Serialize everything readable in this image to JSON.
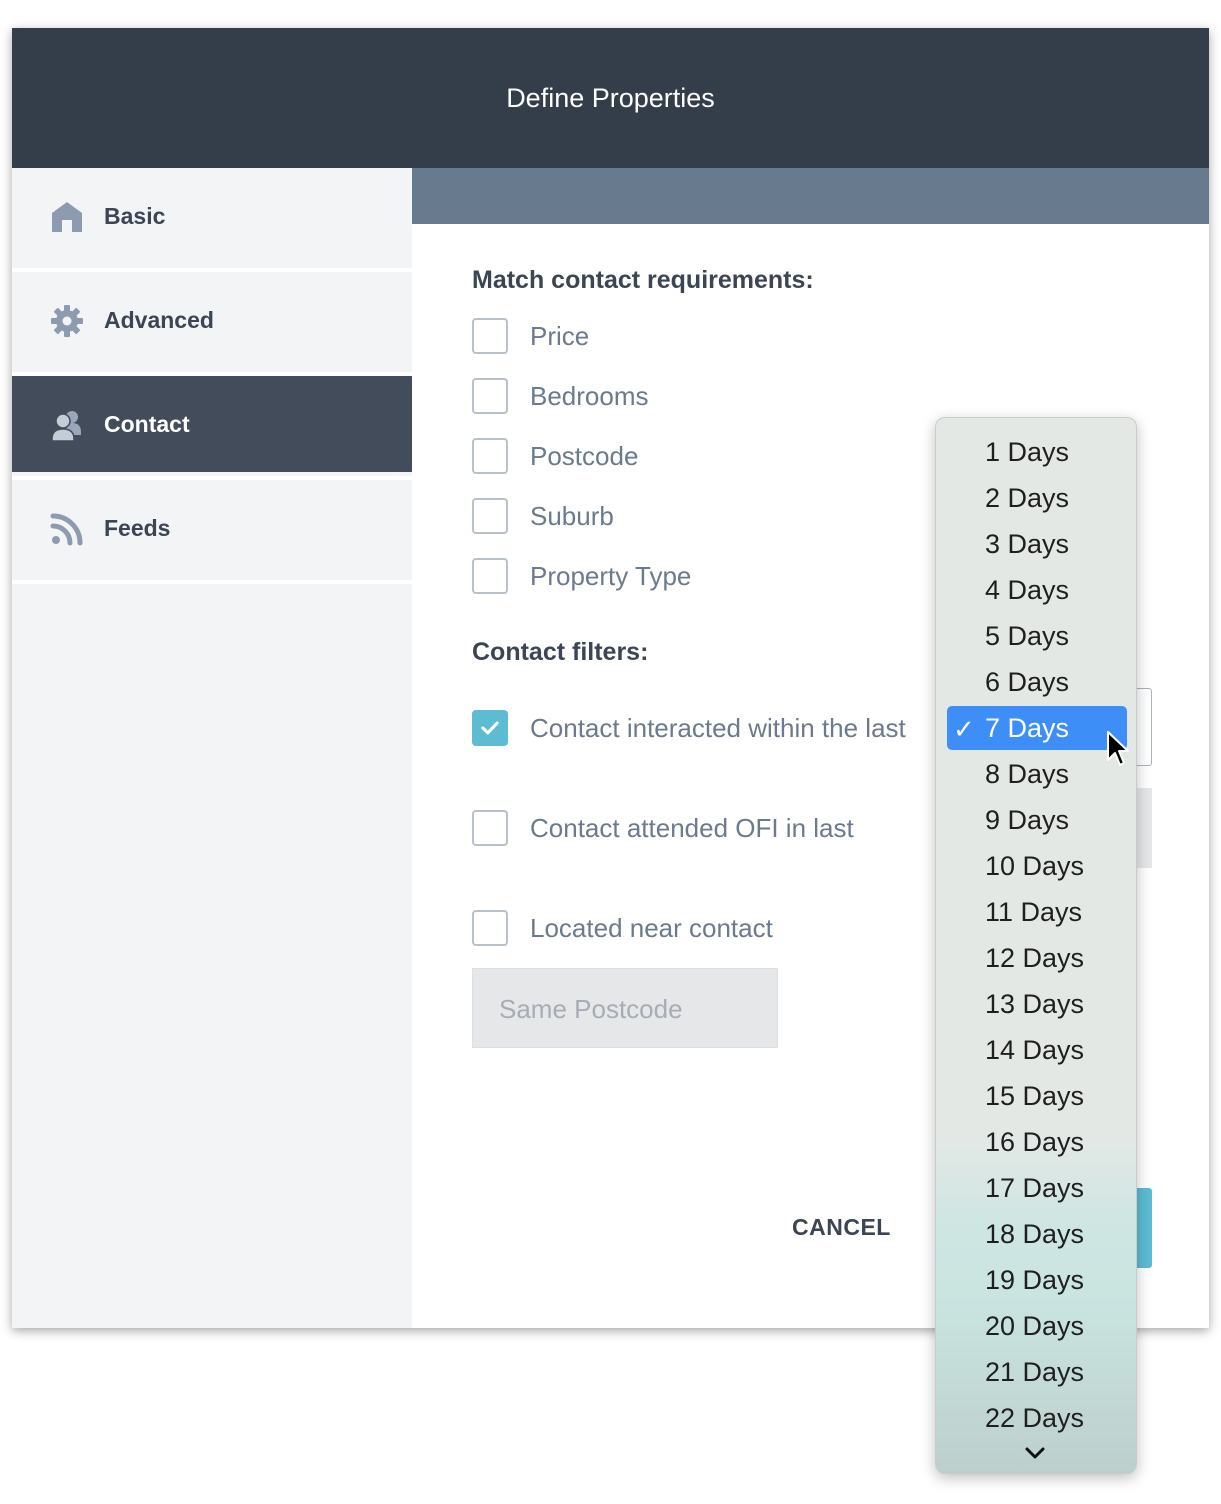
{
  "header": {
    "title": "Define Properties"
  },
  "sidebar": {
    "items": [
      {
        "label": "Basic",
        "icon": "home-icon",
        "active": false
      },
      {
        "label": "Advanced",
        "icon": "gear-icon",
        "active": false
      },
      {
        "label": "Contact",
        "icon": "contacts-icon",
        "active": true
      },
      {
        "label": "Feeds",
        "icon": "rss-icon",
        "active": false
      }
    ]
  },
  "match": {
    "title": "Match contact requirements:",
    "items": [
      {
        "label": "Price",
        "checked": false
      },
      {
        "label": "Bedrooms",
        "checked": false
      },
      {
        "label": "Postcode",
        "checked": false
      },
      {
        "label": "Suburb",
        "checked": false
      },
      {
        "label": "Property Type",
        "checked": false
      }
    ]
  },
  "filters": {
    "title": "Contact filters:",
    "interacted": {
      "label": "Contact interacted within the last",
      "checked": true
    },
    "attended": {
      "label": "Contact attended OFI in last",
      "checked": false
    },
    "near": {
      "label": "Located near contact",
      "checked": false
    },
    "near_select": {
      "value": "Same Postcode"
    }
  },
  "actions": {
    "cancel_label": "CANCEL"
  },
  "dropdown": {
    "selected": "7 Days",
    "checkmark": "✓",
    "options": [
      "1 Days",
      "2 Days",
      "3 Days",
      "4 Days",
      "5 Days",
      "6 Days",
      "7 Days",
      "8 Days",
      "9 Days",
      "10 Days",
      "11 Days",
      "12 Days",
      "13 Days",
      "14 Days",
      "15 Days",
      "16 Days",
      "17 Days",
      "18 Days",
      "19 Days",
      "20 Days",
      "21 Days",
      "22 Days"
    ]
  },
  "colors": {
    "header_bg": "#343d4a",
    "active_nav_bg": "#434c5b",
    "subbar_bg": "#687a8e",
    "checkbox_checked": "#5bbcd3",
    "dropdown_highlight": "#3d8ef6"
  }
}
